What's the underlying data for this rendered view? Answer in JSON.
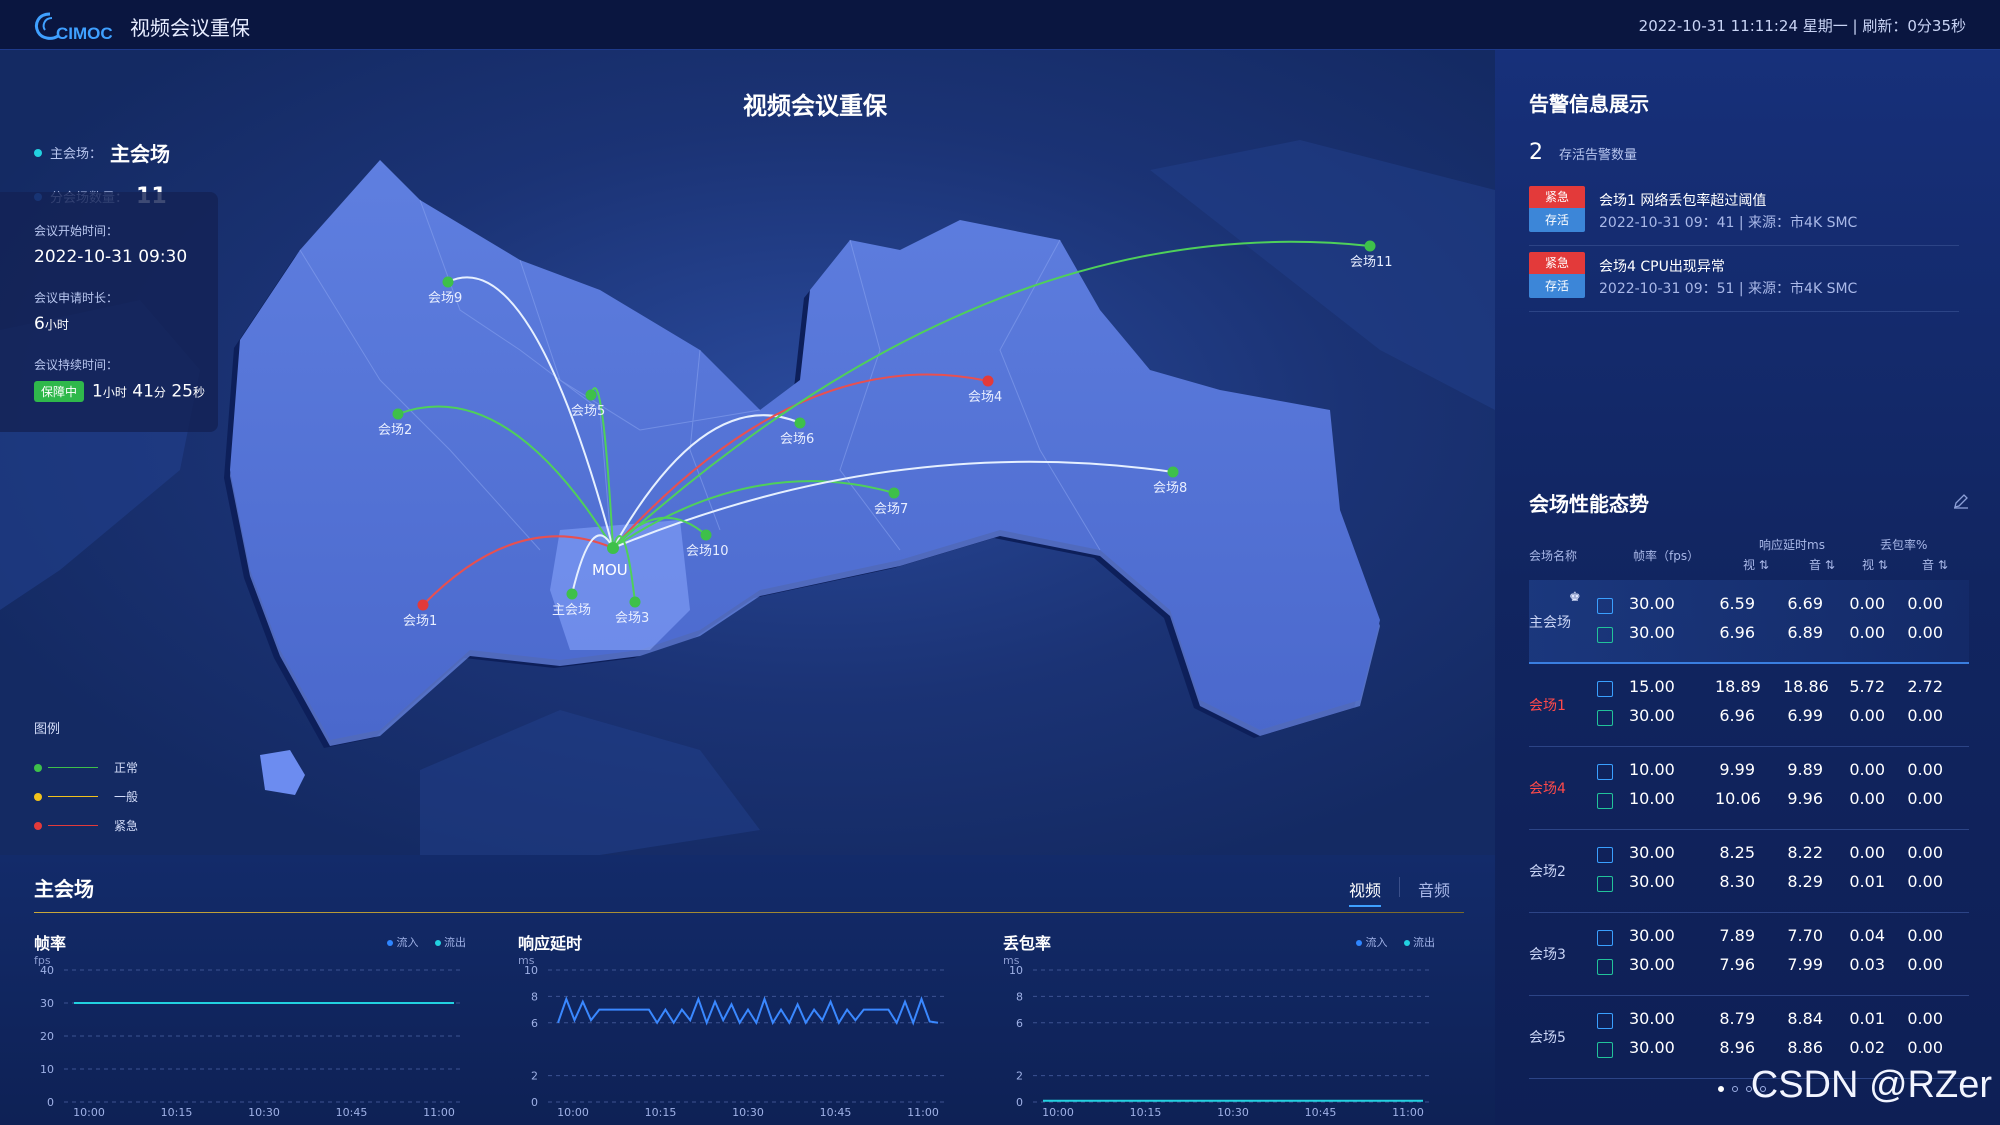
{
  "header": {
    "logo_text": "CIMOC",
    "title": "视频会议重保",
    "datetime": "2022-10-31  11:11:24  星期一",
    "refresh_label": "刷新：0分35秒"
  },
  "map": {
    "title": "视频会议重保",
    "main_venue_label": "主会场：",
    "main_venue_value": "主会场",
    "sub_count_label": "分会场数量：",
    "sub_count_value": "11",
    "hub_label": "MOU",
    "sites": [
      "会场9",
      "会场5",
      "会场2",
      "会场6",
      "会场4",
      "会场7",
      "会场8",
      "会场10",
      "会场1",
      "主会场",
      "会场3",
      "会场11"
    ],
    "legend_title": "图例",
    "legend": [
      {
        "label": "正常",
        "color": "#3ec04a"
      },
      {
        "label": "一般",
        "color": "#f2c21b"
      },
      {
        "label": "紧急",
        "color": "#e33a3a"
      }
    ]
  },
  "meeting": {
    "start_label": "会议开始时间：",
    "start_value": "2022-10-31  09:30",
    "duration_label": "会议申请时长：",
    "duration_value": "6",
    "duration_unit": "小时",
    "elapsed_label": "会议持续时间：",
    "status_badge": "保障中",
    "elapsed_h": "1",
    "elapsed_h_unit": "小时",
    "elapsed_m": "41",
    "elapsed_m_unit": "分",
    "elapsed_s": "25",
    "elapsed_s_unit": "秒"
  },
  "bottom": {
    "title": "主会场",
    "tabs": [
      "视频",
      "音频"
    ],
    "charts": [
      {
        "title": "帧率",
        "unit": "fps",
        "legend_in": "流入",
        "legend_out": "流出",
        "yticks": [
          "40",
          "30",
          "20",
          "10",
          "0"
        ],
        "xticks": [
          "10:00",
          "10:15",
          "10:30",
          "10:45",
          "11:00"
        ]
      },
      {
        "title": "响应延时",
        "unit": "ms",
        "yticks": [
          "10",
          "8",
          "6",
          "2",
          "0"
        ],
        "xticks": [
          "10:00",
          "10:15",
          "10:30",
          "10:45",
          "11:00"
        ]
      },
      {
        "title": "丢包率",
        "unit": "ms",
        "legend_in": "流入",
        "legend_out": "流出",
        "yticks": [
          "10",
          "8",
          "6",
          "2",
          "0"
        ],
        "xticks": [
          "10:00",
          "10:15",
          "10:30",
          "10:45",
          "11:00"
        ]
      }
    ]
  },
  "alarms": {
    "title": "告警信息展示",
    "count": "2",
    "count_label": "存活告警数量",
    "items": [
      {
        "level": "紧急",
        "state": "存活",
        "text": "会场1    网络丢包率超过阈值",
        "sub": "2022-10-31  09：41    |    来源：市4K SMC"
      },
      {
        "level": "紧急",
        "state": "存活",
        "text": "会场4    CPU出现异常",
        "sub": "2022-10-31  09：51    |    来源：市4K SMC"
      }
    ]
  },
  "performance": {
    "title": "会场性能态势",
    "headers": {
      "name": "会场名称",
      "fps": "帧率（fps）",
      "latency": "响应延时ms",
      "loss": "丢包率%",
      "video": "视 ⇅",
      "audio": "音 ⇅"
    },
    "rows": [
      {
        "name": "主会场",
        "alert": false,
        "in": [
          "30.00",
          "6.59",
          "6.69",
          "0.00",
          "0.00"
        ],
        "out": [
          "30.00",
          "6.96",
          "6.89",
          "0.00",
          "0.00"
        ]
      },
      {
        "name": "会场1",
        "alert": true,
        "in": [
          "15.00",
          "18.89",
          "18.86",
          "5.72",
          "2.72"
        ],
        "out": [
          "30.00",
          "6.96",
          "6.99",
          "0.00",
          "0.00"
        ]
      },
      {
        "name": "会场4",
        "alert": true,
        "in": [
          "10.00",
          "9.99",
          "9.89",
          "0.00",
          "0.00"
        ],
        "out": [
          "10.00",
          "10.06",
          "9.96",
          "0.00",
          "0.00"
        ]
      },
      {
        "name": "会场2",
        "alert": false,
        "in": [
          "30.00",
          "8.25",
          "8.22",
          "0.00",
          "0.00"
        ],
        "out": [
          "30.00",
          "8.30",
          "8.29",
          "0.01",
          "0.00"
        ]
      },
      {
        "name": "会场3",
        "alert": false,
        "in": [
          "30.00",
          "7.89",
          "7.70",
          "0.04",
          "0.00"
        ],
        "out": [
          "30.00",
          "7.96",
          "7.99",
          "0.03",
          "0.00"
        ]
      },
      {
        "name": "会场5",
        "alert": false,
        "in": [
          "30.00",
          "8.79",
          "8.84",
          "0.01",
          "0.00"
        ],
        "out": [
          "30.00",
          "8.96",
          "8.86",
          "0.02",
          "0.00"
        ]
      }
    ]
  },
  "watermark": "CSDN @RZer"
}
